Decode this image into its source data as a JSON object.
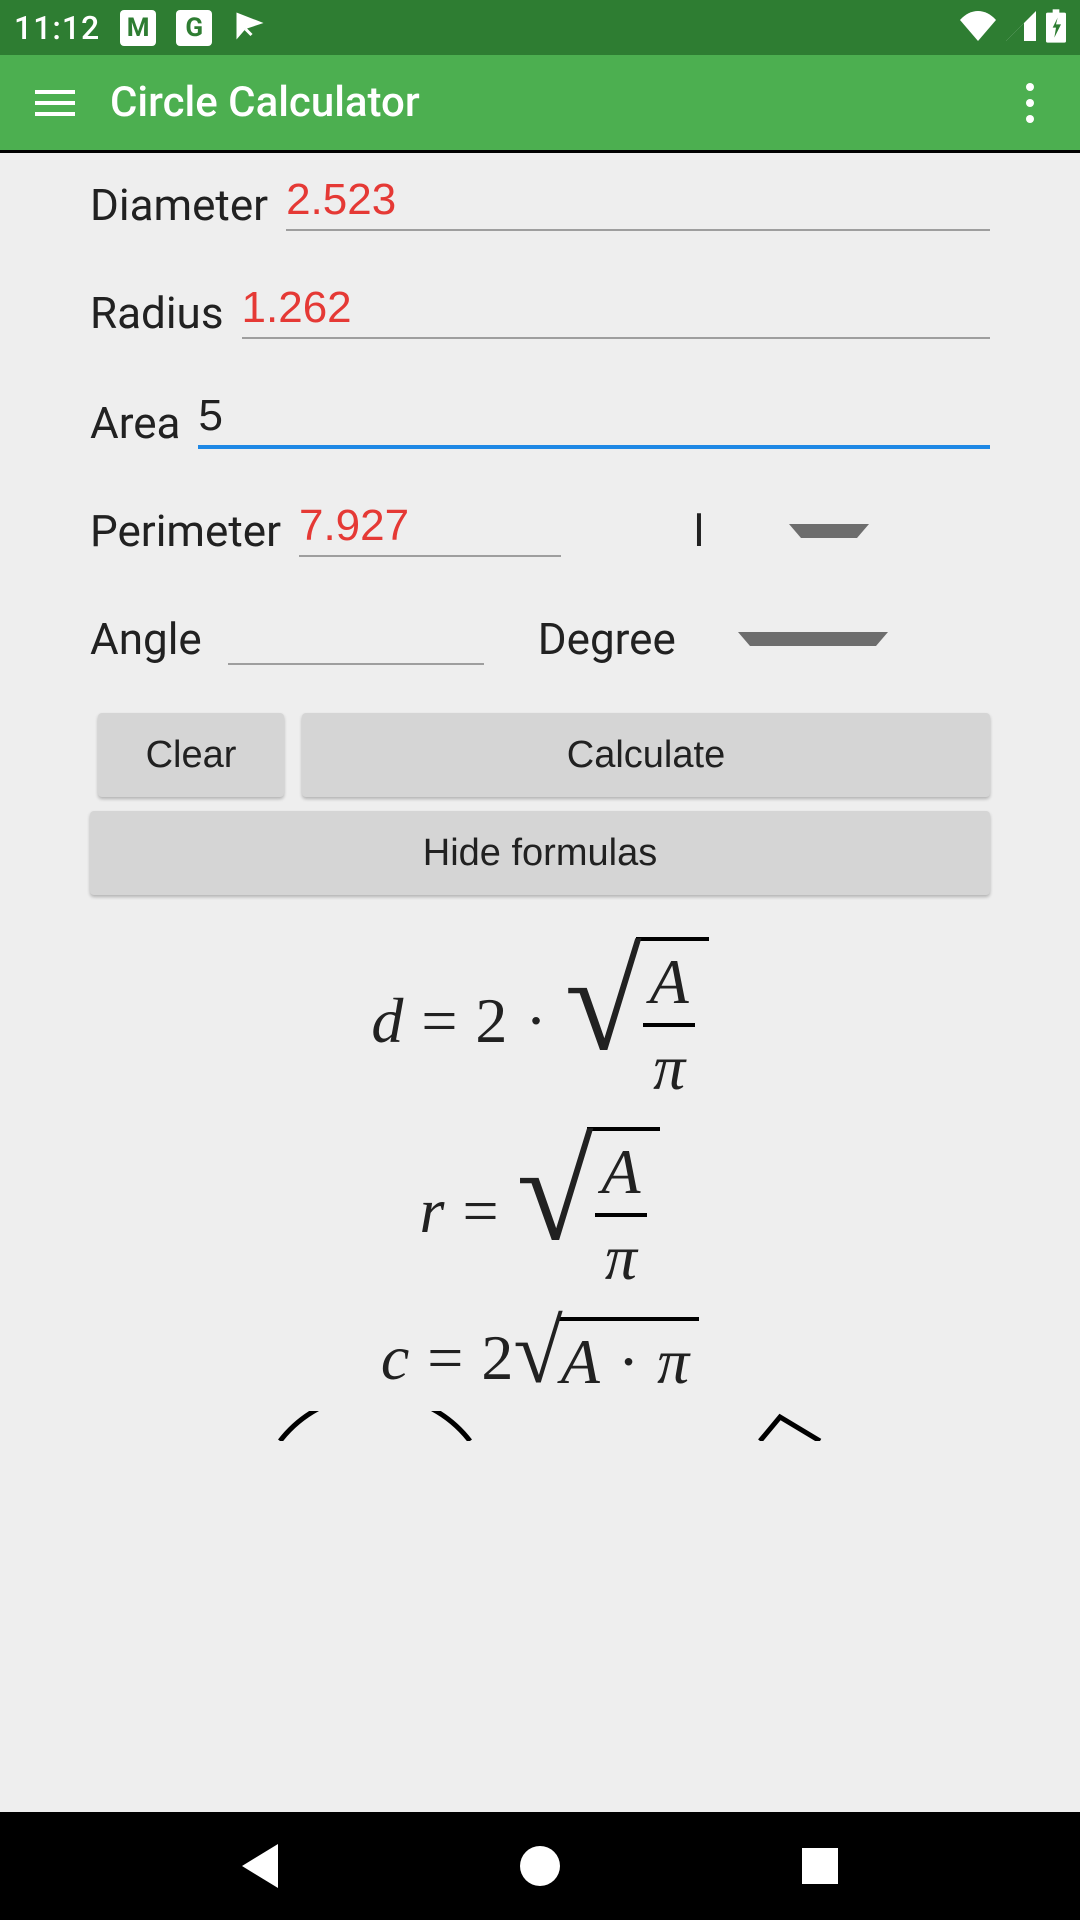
{
  "status": {
    "time": "11:12"
  },
  "appbar": {
    "title": "Circle Calculator"
  },
  "fields": {
    "diameter": {
      "label": "Diameter",
      "value": "2.523"
    },
    "radius": {
      "label": "Radius",
      "value": "1.262"
    },
    "area": {
      "label": "Area",
      "value": "5"
    },
    "perimeter": {
      "label": "Perimeter",
      "value": "7.927",
      "unit": "l"
    },
    "angle": {
      "label": "Angle",
      "value": "",
      "unit": "Degree"
    }
  },
  "buttons": {
    "clear": "Clear",
    "calculate": "Calculate",
    "hide_formulas": "Hide formulas"
  },
  "formulas": {
    "A": "A",
    "pi": "π",
    "d": "d",
    "r": "r",
    "c": "c",
    "eq": "=",
    "two": "2",
    "dot": "·"
  }
}
